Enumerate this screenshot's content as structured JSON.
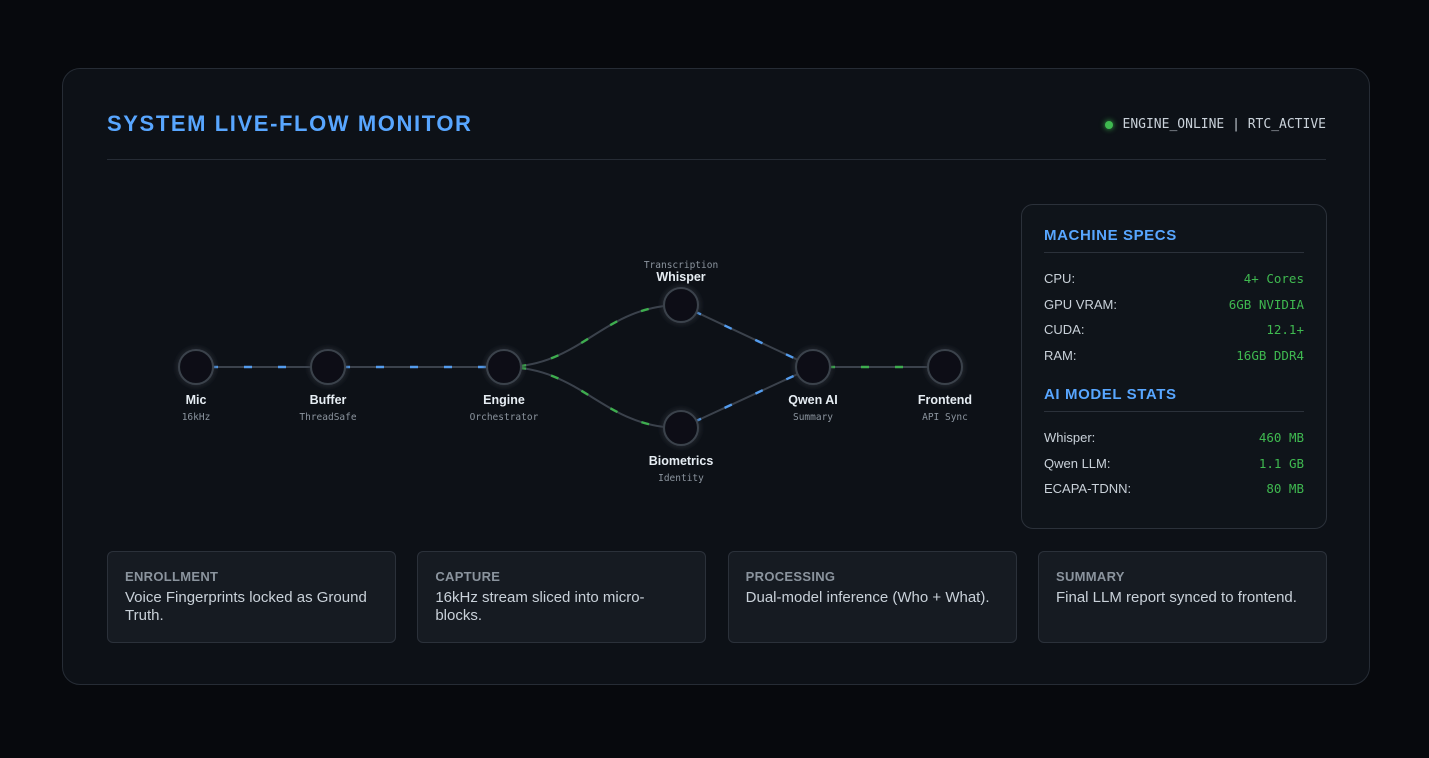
{
  "header": {
    "title": "SYSTEM LIVE-FLOW MONITOR",
    "status": "ENGINE_ONLINE | RTC_ACTIVE"
  },
  "colors": {
    "accent": "#58a6ff",
    "status": "#3fb950",
    "edge": "#3b424c",
    "node_fill": "#0d1117",
    "node_stroke": "#3b424c"
  },
  "flow": {
    "nodes": [
      {
        "id": "mic",
        "label": "Mic",
        "sub": "16kHz",
        "top": ""
      },
      {
        "id": "buffer",
        "label": "Buffer",
        "sub": "ThreadSafe",
        "top": ""
      },
      {
        "id": "engine",
        "label": "Engine",
        "sub": "Orchestrator",
        "top": ""
      },
      {
        "id": "whisper",
        "label": "Whisper",
        "sub": "",
        "top": "Transcription"
      },
      {
        "id": "biometrics",
        "label": "Biometrics",
        "sub": "Identity",
        "top": ""
      },
      {
        "id": "qwen",
        "label": "Qwen AI",
        "sub": "Summary",
        "top": ""
      },
      {
        "id": "frontend",
        "label": "Frontend",
        "sub": "API Sync",
        "top": ""
      }
    ],
    "edges": [
      {
        "from": "mic",
        "to": "buffer",
        "pulse": "blue"
      },
      {
        "from": "buffer",
        "to": "engine",
        "pulse": "blue"
      },
      {
        "from": "engine",
        "to": "whisper",
        "pulse": "green"
      },
      {
        "from": "engine",
        "to": "biometrics",
        "pulse": "green"
      },
      {
        "from": "whisper",
        "to": "qwen",
        "pulse": "blue"
      },
      {
        "from": "biometrics",
        "to": "qwen",
        "pulse": "blue"
      },
      {
        "from": "qwen",
        "to": "frontend",
        "pulse": "green"
      }
    ]
  },
  "specs": {
    "machine_title": "MACHINE SPECS",
    "machine": [
      {
        "k": "CPU:",
        "v": "4+ Cores"
      },
      {
        "k": "GPU VRAM:",
        "v": "6GB NVIDIA"
      },
      {
        "k": "CUDA:",
        "v": "12.1+"
      },
      {
        "k": "RAM:",
        "v": "16GB DDR4"
      }
    ],
    "model_title": "AI MODEL STATS",
    "models": [
      {
        "k": "Whisper:",
        "v": "460 MB"
      },
      {
        "k": "Qwen LLM:",
        "v": "1.1 GB"
      },
      {
        "k": "ECAPA-TDNN:",
        "v": "80 MB"
      }
    ]
  },
  "stages": [
    {
      "title": "ENROLLMENT",
      "desc": "Voice Fingerprints locked as Ground Truth."
    },
    {
      "title": "CAPTURE",
      "desc": "16kHz stream sliced into micro-blocks."
    },
    {
      "title": "PROCESSING",
      "desc": "Dual-model inference (Who + What)."
    },
    {
      "title": "SUMMARY",
      "desc": "Final LLM report synced to frontend."
    }
  ]
}
